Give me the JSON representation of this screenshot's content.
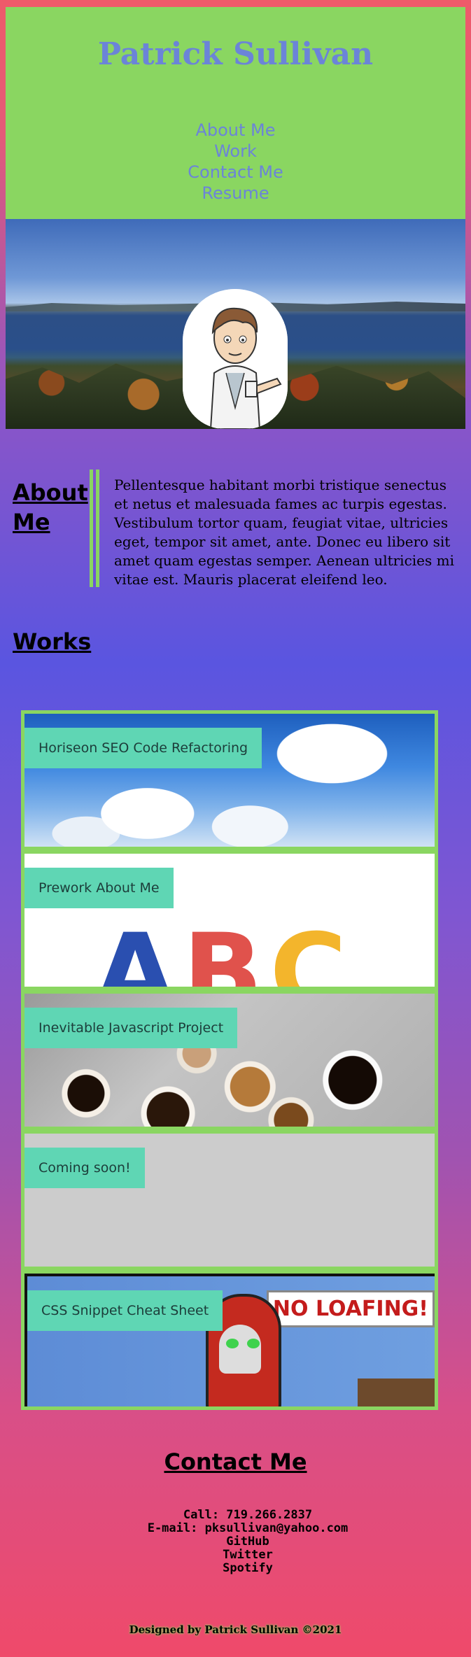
{
  "header": {
    "title": "Patrick Sullivan",
    "nav": [
      "About Me",
      "Work",
      "Contact Me",
      "Resume"
    ]
  },
  "about": {
    "heading": "About Me",
    "body": "Pellentesque habitant morbi tristique senectus et netus et malesuada fames ac turpis egestas. Vestibulum tortor quam, feugiat vitae, ultricies eget, tempor sit amet, ante. Donec eu libero sit amet quam egestas semper. Aenean ultricies mi vitae est. Mauris placerat eleifend leo."
  },
  "works": {
    "heading": "Works",
    "items": [
      {
        "label": "Horiseon SEO Code Refactoring"
      },
      {
        "label": "Prework About Me"
      },
      {
        "label": "Inevitable Javascript Project"
      },
      {
        "label": "Coming soon!"
      },
      {
        "label": "CSS Snippet Cheat Sheet"
      }
    ],
    "prework_image_text": "ABC",
    "cheat_sheet_sign": "NO LOAFING!"
  },
  "contact": {
    "heading": "Contact Me",
    "call": "Call: 719.266.2837",
    "email": "E-mail: pksullivan@yahoo.com",
    "links": [
      "GitHub",
      "Twitter",
      "Spotify"
    ]
  },
  "footer": {
    "text": "Designed by Patrick Sullivan ©2021"
  },
  "colors": {
    "header_bg": "#8ad661",
    "title_color": "#6b84d8",
    "label_bg": "#5fd6b4"
  }
}
